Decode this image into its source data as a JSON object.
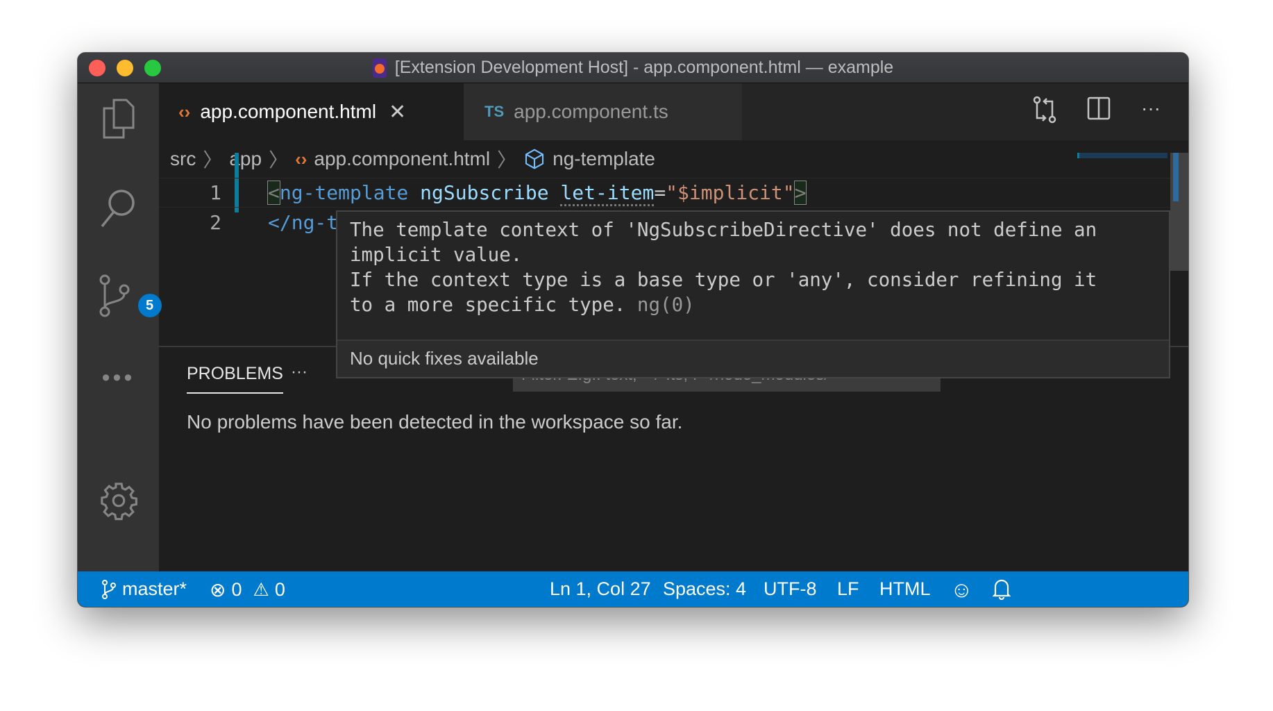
{
  "window": {
    "title": "[Extension Development Host] - app.component.html — example"
  },
  "activity_bar": {
    "scm_badge": "5"
  },
  "tabs": [
    {
      "label": "app.component.html",
      "icon": "html-brackets-icon",
      "active": true
    },
    {
      "label": "app.component.ts",
      "icon": "TS",
      "active": false
    }
  ],
  "breadcrumb": [
    "src",
    "app",
    "app.component.html",
    "ng-template"
  ],
  "editor": {
    "lines": [
      {
        "num": "1"
      },
      {
        "num": "2",
        "text": "</ng-t"
      }
    ],
    "line1": {
      "open": "<",
      "tag": "ng-template",
      "attr1": "ngSubscribe",
      "attr2": "let-item",
      "eq": "=",
      "value": "\"$implicit\"",
      "close": ">"
    }
  },
  "hover": {
    "lines": [
      "The template context of 'NgSubscribeDirective' does not define an",
      "implicit value.",
      "If the context type is a base type or 'any', consider refining it",
      "to a more specific type."
    ],
    "source": "ng(0)",
    "footer": "No quick fixes available"
  },
  "panel": {
    "tab": "PROBLEMS",
    "more": "···",
    "filter_placeholder": "Filter. E.g.: text, **/*.ts, !**/node_modules/**",
    "message": "No problems have been detected in the workspace so far."
  },
  "status": {
    "branch": "master*",
    "errors": "0",
    "warnings": "0",
    "position": "Ln 1, Col 27",
    "spaces": "Spaces: 4",
    "encoding": "UTF-8",
    "eol": "LF",
    "language": "HTML"
  },
  "colors": {
    "accent": "#007acc",
    "tag": "#569cd6",
    "attr": "#9cdcfe",
    "string": "#ce9178"
  }
}
